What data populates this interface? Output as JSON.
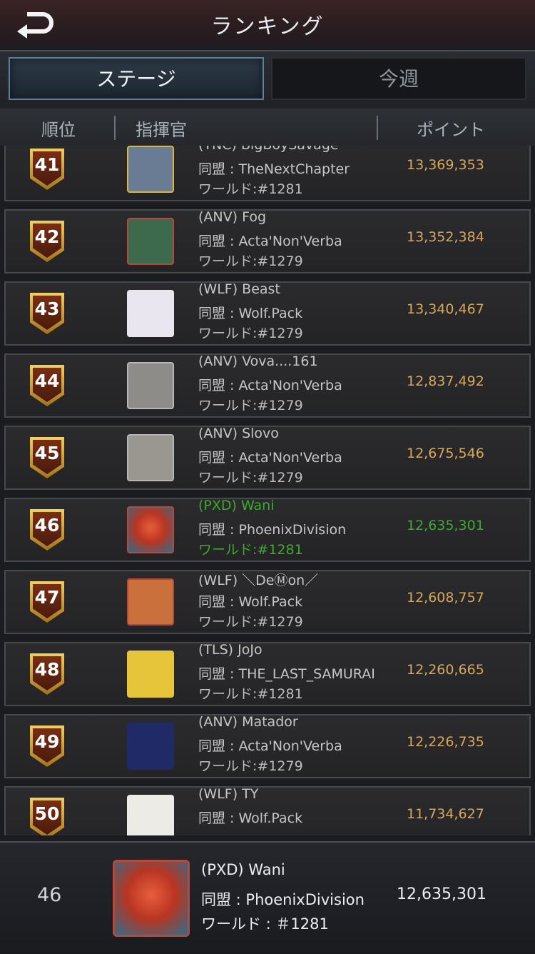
{
  "header": {
    "title": "ランキング",
    "back_icon": "back-arrow-icon"
  },
  "tabs": [
    {
      "label": "ステージ",
      "active": true
    },
    {
      "label": "今週",
      "active": false
    }
  ],
  "columns": {
    "rank": "順位",
    "commander": "指揮官",
    "points": "ポイント"
  },
  "rows": [
    {
      "rank": "41",
      "name": "(TNC) BigBoySavage",
      "alliance": "同盟 : TheNextChapter",
      "world": "ワールド:#1281",
      "points": "13,369,353",
      "avatar_color": "#6a7c93",
      "frame": "gold",
      "highlight": false
    },
    {
      "rank": "42",
      "name": "(ANV) Fog",
      "alliance": "同盟 : Acta'Non'Verba",
      "world": "ワールド:#1279",
      "points": "13,352,384",
      "avatar_color": "#3d6a4c",
      "frame": "red",
      "highlight": false
    },
    {
      "rank": "43",
      "name": "(WLF) Beast",
      "alliance": "同盟 : Wolf.Pack",
      "world": "ワールド:#1279",
      "points": "13,340,467",
      "avatar_color": "#e9e6ef",
      "frame": "none",
      "highlight": false
    },
    {
      "rank": "44",
      "name": "(ANV) Vova....161",
      "alliance": "同盟 : Acta'Non'Verba",
      "world": "ワールド:#1279",
      "points": "12,837,492",
      "avatar_color": "#8d8c88",
      "frame": "silver",
      "highlight": false
    },
    {
      "rank": "45",
      "name": "(ANV) Slovo",
      "alliance": "同盟 : Acta'Non'Verba",
      "world": "ワールド:#1279",
      "points": "12,675,546",
      "avatar_color": "#9a9791",
      "frame": "silver",
      "highlight": false
    },
    {
      "rank": "46",
      "name": "(PXD) Wani",
      "alliance": "同盟 : PhoenixDivision",
      "world": "ワールド:#1281",
      "points": "12,635,301",
      "avatar_color": "#c0412a",
      "frame": "red",
      "highlight": true
    },
    {
      "rank": "47",
      "name": "(WLF) ＼DeⓂon／",
      "alliance": "同盟 : Wolf.Pack",
      "world": "ワールド:#1279",
      "points": "12,608,757",
      "avatar_color": "#c9703d",
      "frame": "red",
      "highlight": false
    },
    {
      "rank": "48",
      "name": "(TLS) JoJo",
      "alliance": "同盟 : THE_LAST_SAMURAI",
      "world": "ワールド:#1281",
      "points": "12,260,665",
      "avatar_color": "#e6c53a",
      "frame": "none",
      "highlight": false
    },
    {
      "rank": "49",
      "name": "(ANV) Matador",
      "alliance": "同盟 : Acta'Non'Verba",
      "world": "ワールド:#1279",
      "points": "12,226,735",
      "avatar_color": "#1f2a66",
      "frame": "none",
      "highlight": false
    },
    {
      "rank": "50",
      "name": "(WLF) TY",
      "alliance": "同盟 : Wolf.Pack",
      "world": "",
      "points": "11,734,627",
      "avatar_color": "#ecebe6",
      "frame": "none",
      "highlight": false
    }
  ],
  "footer": {
    "rank": "46",
    "name": "(PXD)  Wani",
    "alliance": "同盟 : PhoenixDivision",
    "world": "ワールド : ＃1281",
    "points": "12,635,301"
  }
}
